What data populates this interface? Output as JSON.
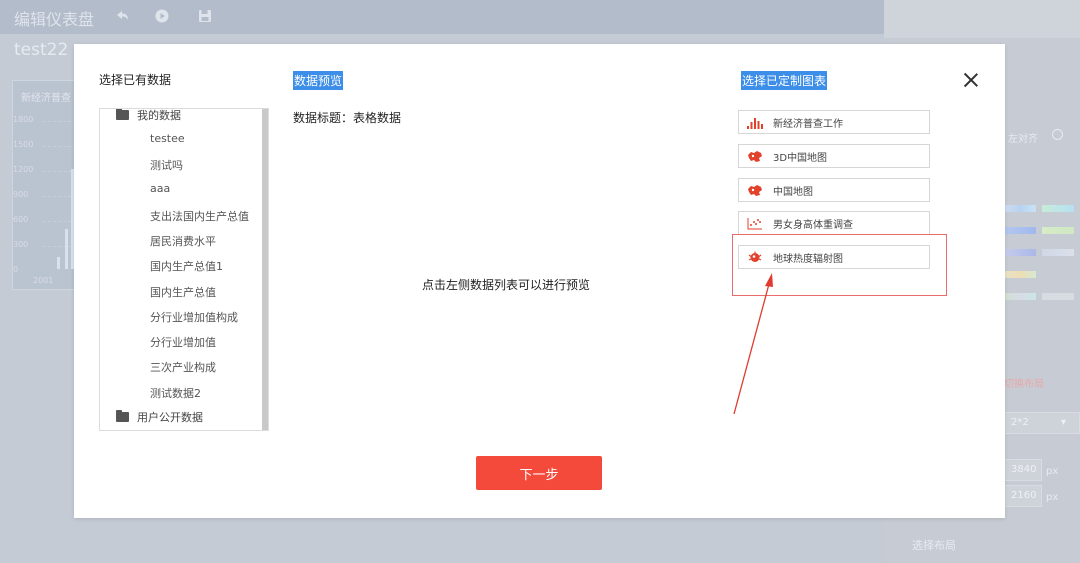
{
  "background": {
    "topbar_title": "编辑仪表盘",
    "dashboard_name": "test22",
    "widget_title": "新经济普查",
    "y_ticks": [
      "1800",
      "1500",
      "1200",
      "900",
      "600",
      "300",
      "0"
    ],
    "x_tick": "2001",
    "right_panel": {
      "align_label": "左对齐",
      "layout_link": "切换布局",
      "grid_select": "2*2",
      "width_value": "3840",
      "height_value": "2160",
      "unit": "px",
      "footer_label": "选择布局"
    }
  },
  "modal": {
    "left_title": "选择已有数据",
    "middle_title": "数据预览",
    "right_title": "选择已定制图表",
    "tree": {
      "my_data_label": "我的数据",
      "items": [
        "testee",
        "测试吗",
        "aaa",
        "支出法国内生产总值",
        "居民消费水平",
        "国内生产总值1",
        "国内生产总值",
        "分行业增加值构成",
        "分行业增加值",
        "三次产业构成",
        "测试数据2"
      ],
      "public_data_label": "用户公开数据"
    },
    "preview": {
      "data_title_label": "数据标题：",
      "data_title_value": "表格数据",
      "hint": "点击左侧数据列表可以进行预览"
    },
    "charts": [
      {
        "label": "新经济普查工作",
        "icon": "bar-chart-icon"
      },
      {
        "label": "3D中国地图",
        "icon": "china-map-icon"
      },
      {
        "label": "中国地图",
        "icon": "china-map-icon"
      },
      {
        "label": "男女身高体重调查",
        "icon": "scatter-chart-icon"
      },
      {
        "label": "地球热度辐射图",
        "icon": "globe-heat-icon"
      }
    ],
    "next_button": "下一步",
    "accent_color": "#f44a3b",
    "highlight_color": "#3d8ee8"
  }
}
